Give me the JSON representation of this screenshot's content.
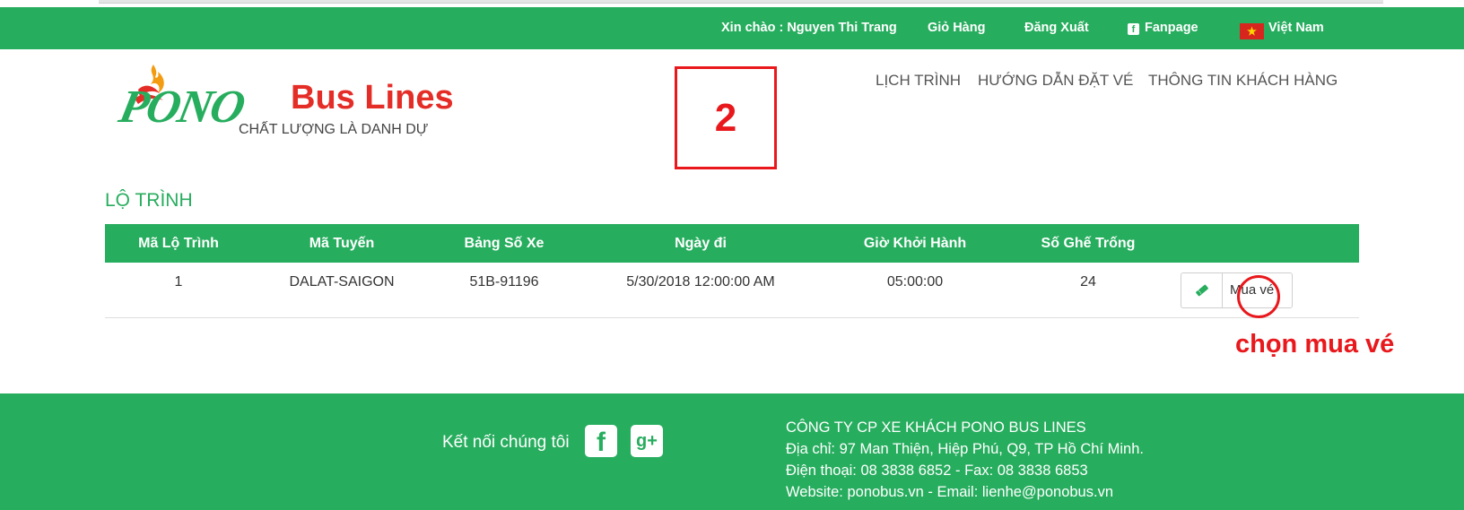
{
  "topbar": {
    "greeting": "Xin chào : Nguyen Thi Trang",
    "cart": "Giỏ Hàng",
    "logout": "Đăng Xuất",
    "fanpage": "Fanpage",
    "language": "Việt Nam",
    "bg_color": "#27ad5e"
  },
  "logo": {
    "brand_word": "PONO",
    "brand_name": "Bus Lines",
    "tagline": "CHẤT LƯỢNG LÀ DANH DỰ"
  },
  "step_annotation": "2",
  "nav": {
    "schedule": "LỊCH TRÌNH",
    "booking_guide": "HƯỚNG DẪN ĐẶT VÉ",
    "customer_info": "THÔNG TIN KHÁCH HÀNG"
  },
  "section_title": "LỘ TRÌNH",
  "table": {
    "headers": [
      "Mã Lộ Trình",
      "Mã Tuyến",
      "Bảng Số Xe",
      "Ngày đi",
      "Giờ Khởi Hành",
      "Số Ghế Trống"
    ],
    "rows": [
      {
        "route_id": "1",
        "line_code": "DALAT-SAIGON",
        "plate": "51B-91196",
        "date": "5/30/2018 12:00:00 AM",
        "depart_time": "05:00:00",
        "seats": "24",
        "action_label": "Mua vé",
        "action_icon": "ticket-icon"
      }
    ]
  },
  "annotation_text": "chọn mua vé",
  "footer": {
    "connect_label": "Kết nối chúng tôi",
    "company": "CÔNG TY CP XE KHÁCH PONO BUS LINES",
    "address": "Địa chỉ: 97 Man Thiện, Hiệp Phú, Q9, TP Hồ Chí Minh.",
    "phone": "Điện thoại: 08 3838 6852 - Fax: 08 3838 6853",
    "web": "Website: ponobus.vn - Email: lienhe@ponobus.vn"
  },
  "colors": {
    "brand_green": "#27ad5e",
    "brand_red": "#e52d27",
    "annotation_red": "#e8181c"
  }
}
